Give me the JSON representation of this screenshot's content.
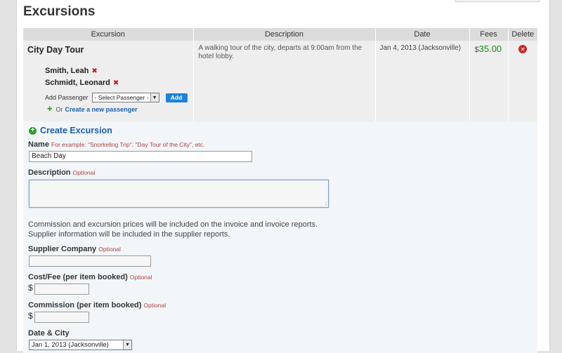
{
  "page": {
    "title": "Excursions"
  },
  "table": {
    "headers": [
      "Excursion",
      "Description",
      "Date",
      "Fees",
      "Delete"
    ],
    "row": {
      "name": "City Day Tour",
      "passengers": [
        "Smith, Leah",
        "Schmidt, Leonard"
      ],
      "remove_glyph": "✖",
      "add_passenger_label": "Add Passenger",
      "select_passenger_value": "- Select Passenger -",
      "add_button_label": "Add",
      "or_text": "Or",
      "create_passenger_link": "Create a new passenger",
      "description": "A walking tour of the city, departs at 9:00am from the hotel lobby.",
      "date": "Jan 4, 2013 (Jacksonville)",
      "fee_currency": "$",
      "fee_amount": "35.00"
    }
  },
  "form": {
    "heading": "Create Excursion",
    "name_label": "Name",
    "name_hint": "For example: \"Snorkeling Trip\", \"Day Tour of the City\", etc.",
    "name_value": "Beach Day",
    "description_label": "Description",
    "description_hint": "Optional",
    "info_line1": "Commission and excursion prices will be included on the invoice and invoice reports.",
    "info_line2": "Supplier information will be included in the supplier reports.",
    "supplier_label": "Supplier Company",
    "supplier_hint": "Optional",
    "cost_label": "Cost/Fee (per item booked)",
    "cost_hint": "Optional",
    "currency": "$",
    "commission_label": "Commission (per item booked)",
    "commission_hint": "Optional",
    "date_city_label": "Date & City",
    "date_city_value": "Jan 1, 2013 (Jacksonville)"
  },
  "colors": {
    "accent": "#1f82e0",
    "link": "#1a5fb4",
    "fee": "#1a8a1a",
    "remove": "#c01a1a"
  }
}
